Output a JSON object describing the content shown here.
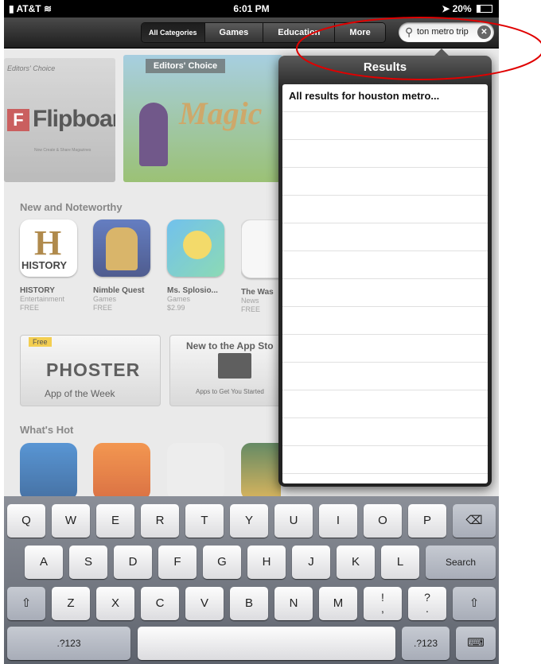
{
  "status_bar": {
    "carrier": "AT&T",
    "time": "6:01 PM",
    "battery": "20%"
  },
  "nav": {
    "segments": [
      "All Categories",
      "Games",
      "Education",
      "More"
    ],
    "search": {
      "value": "ton metro trip"
    }
  },
  "banners": {
    "left": {
      "label": "Editors' Choice",
      "logo_letter": "F",
      "name": "Flipboard",
      "subtitle": "Now Create & Share Magazines"
    },
    "center": {
      "label": "Editors' Choice",
      "title": "Magic"
    }
  },
  "sections": {
    "new": "New and Noteworthy",
    "hot": "What's Hot"
  },
  "apps": [
    {
      "name": "HISTORY",
      "category": "Entertainment",
      "price": "FREE",
      "icon_text": "H",
      "icon_sub": "HISTORY"
    },
    {
      "name": "Nimble Quest",
      "category": "Games",
      "price": "FREE"
    },
    {
      "name": "Ms. Splosio...",
      "category": "Games",
      "price": "$2.99"
    },
    {
      "name": "The Was",
      "category": "News",
      "price": "FREE"
    }
  ],
  "app_of_week": {
    "badge": "Free",
    "title": "PHOSTER",
    "caption": "App of the Week"
  },
  "new_to_store": {
    "title": "New to the App Sto",
    "caption": "Apps to Get You Started"
  },
  "results": {
    "title": "Results",
    "first_row": "All results for houston metro..."
  },
  "keyboard": {
    "row1": [
      "Q",
      "W",
      "E",
      "R",
      "T",
      "Y",
      "U",
      "I",
      "O",
      "P"
    ],
    "row2": [
      "A",
      "S",
      "D",
      "F",
      "G",
      "H",
      "J",
      "K",
      "L"
    ],
    "row3": [
      "Z",
      "X",
      "C",
      "V",
      "B",
      "N",
      "M"
    ],
    "punct1": {
      "top": "!",
      "bottom": ","
    },
    "punct2": {
      "top": "?",
      "bottom": "."
    },
    "search": "Search",
    "numbers": ".?123",
    "numbers_right": ".?123",
    "backspace_icon": "backspace-icon",
    "shift_icon": "shift-icon",
    "hide_icon": "keyboard-hide-icon"
  },
  "colors": {
    "annotation": "#e00000"
  }
}
